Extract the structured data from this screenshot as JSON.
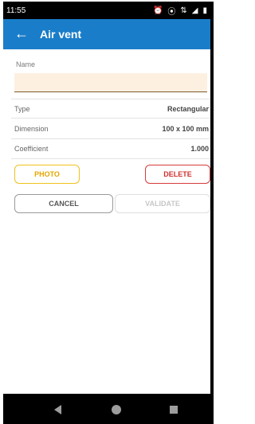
{
  "status_bar": {
    "time": "11:55",
    "icons": [
      "alarm-icon",
      "vibrate-icon",
      "data-icon",
      "signal-icon",
      "battery-icon"
    ]
  },
  "app_bar": {
    "title": "Air vent",
    "color": "#1a7dc9"
  },
  "form": {
    "name_label": "Name",
    "name_value": "",
    "fields": [
      {
        "label": "Type",
        "value": "Rectangular"
      },
      {
        "label": "Dimension",
        "value": "100 x 100 mm"
      },
      {
        "label": "Coefficient",
        "value": "1.000"
      }
    ]
  },
  "buttons": {
    "photo": "PHOTO",
    "delete": "DELETE",
    "cancel": "CANCEL",
    "validate": "VALIDATE"
  },
  "colors": {
    "photo": "#e3a700",
    "delete": "#d13131",
    "input_bg": "#fdf0e1"
  }
}
